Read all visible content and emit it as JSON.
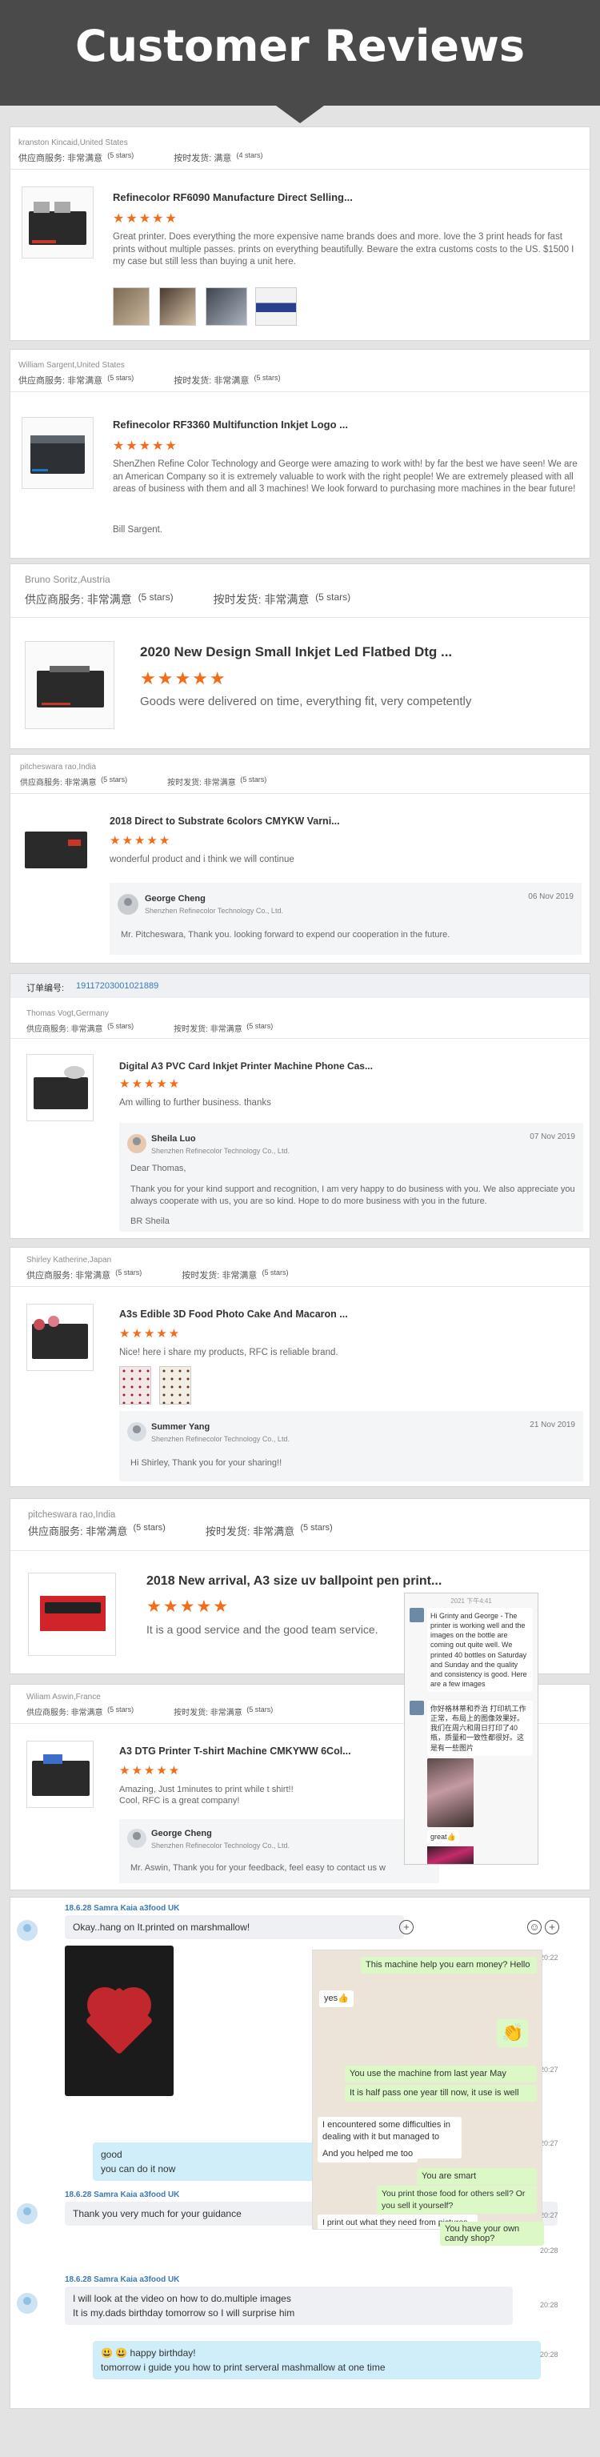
{
  "header": {
    "title": "Customer Reviews"
  },
  "labels": {
    "supplier": "供应商服务:",
    "shipping": "按时发货:",
    "very_satisfied": "非常满意",
    "satisfied": "满意",
    "five_stars": "(5 stars)",
    "four_stars": "(4 stars)",
    "stars_glyph": "★★★★★"
  },
  "reviews": [
    {
      "customer": "kranston Kincaid,United States",
      "supplier_rating": "非常满意",
      "supplier_stars": "(5 stars)",
      "shipping_rating": "满意",
      "shipping_stars": "(4 stars)",
      "product": "Refinecolor RF6090 Manufacture Direct Selling...",
      "stars": 5,
      "text": "Great printer. Does everything the more expensive name brands does and more. love the 3 print heads for fast prints without multiple passes. prints on everything beautifully. Beware the extra customs costs to the US. $1500 I my case but still less than buying a unit here."
    },
    {
      "customer": "William Sargent,United States",
      "supplier_rating": "非常满意",
      "supplier_stars": "(5 stars)",
      "shipping_rating": "非常满意",
      "shipping_stars": "(5 stars)",
      "product": "Refinecolor RF3360 Multifunction Inkjet Logo ...",
      "stars": 5,
      "text": "ShenZhen Refine Color Technology and George were amazing to work with! by far the best we have seen! We are an American Company so it is extremely valuable to work with the right people! We are extremely pleased with all areas of business with them and all 3 machines! We look forward to purchasing more machines in the bear future!",
      "signature": "Bill Sargent."
    },
    {
      "customer": "Bruno Soritz,Austria",
      "supplier_rating": "非常满意",
      "supplier_stars": "(5 stars)",
      "shipping_rating": "非常满意",
      "shipping_stars": "(5 stars)",
      "product": "2020 New Design Small Inkjet Led Flatbed Dtg ...",
      "stars": 5,
      "text": "Goods were delivered on time, everything fit, very competently"
    },
    {
      "customer": "pitcheswara rao,India",
      "supplier_rating": "非常满意",
      "supplier_stars": "(5 stars)",
      "shipping_rating": "非常满意",
      "shipping_stars": "(5 stars)",
      "product": "2018 Direct to Substrate 6colors CMYKW Varni...",
      "stars": 5,
      "text": "wonderful product and i think we will continue",
      "reply": {
        "name": "George Cheng",
        "company": "Shenzhen Refinecolor Technology Co., Ltd.",
        "date": "06 Nov 2019",
        "text": "Mr. Pitcheswara, Thank you. looking forward to expend our cooperation in the future."
      }
    },
    {
      "order_label": "订单编号:",
      "order_no": "19117203001021889",
      "customer": "Thomas Vogt,Germany",
      "supplier_rating": "非常满意",
      "supplier_stars": "(5 stars)",
      "shipping_rating": "非常满意",
      "shipping_stars": "(5 stars)",
      "product": "Digital A3 PVC Card Inkjet Printer Machine Phone Cas...",
      "stars": 5,
      "text": "Am willing to further business. thanks",
      "reply": {
        "name": "Sheila Luo",
        "company": "Shenzhen Refinecolor Technology Co., Ltd.",
        "date": "07 Nov 2019",
        "greeting": "Dear Thomas,",
        "text": "Thank you for your kind support and recognition, I am very happy to do business with you. We also appreciate you always cooperate with us, you are so kind. Hope to do more business with you in the future.",
        "sign": "BR Sheila"
      }
    },
    {
      "customer": "Shirley Katherine,Japan",
      "supplier_rating": "非常满意",
      "supplier_stars": "(5 stars)",
      "shipping_rating": "非常满意",
      "shipping_stars": "(5 stars)",
      "product": "A3s Edible 3D Food Photo Cake And Macaron ...",
      "stars": 5,
      "text": "Nice! here i share my products,  RFC is reliable brand.",
      "reply": {
        "name": "Summer Yang",
        "company": "Shenzhen Refinecolor Technology Co., Ltd.",
        "date": "21 Nov 2019",
        "text": "Hi Shirley, Thank you for your sharing!!"
      }
    },
    {
      "customer": "pitcheswara rao,India",
      "supplier_rating": "非常满意",
      "supplier_stars": "(5 stars)",
      "shipping_rating": "非常满意",
      "shipping_stars": "(5 stars)",
      "product": "2018 New arrival, A3 size uv ballpoint pen print...",
      "stars": 5,
      "text": "It is a good service and the good team service."
    },
    {
      "customer": "Wiliam Aswin,France",
      "supplier_rating": "非常满意",
      "supplier_stars": "(5 stars)",
      "shipping_rating": "非常满意",
      "shipping_stars": "(5 stars)",
      "product": "A3 DTG Printer T-shirt Machine CMKYWW 6Col...",
      "stars": 5,
      "text": "Amazing, Just 1minutes to print while t shirt!!",
      "text2": "Cool, RFC is a great company!",
      "reply": {
        "name": "George Cheng",
        "company": "Shenzhen Refinecolor Technology Co., Ltd.",
        "text": "Mr. Aswin, Thank you for your feedback, feel easy to contact us w"
      }
    }
  ],
  "cn_chat": {
    "time": "2021 下午4:41",
    "msg1": "Hi Grinty and George - The printer is working well and the images on the bottle are coming out quite well. We printed 40 bottles on Saturday and Sunday and the quality and consistency is good. Here are a few images",
    "msg2": "你好格林蒂和乔治 打印机工作正常，布局上的图像效果好。我们在周六和周日打印了40 瓶，质量和一致性都很好。这是有一些图片",
    "great": "great👍"
  },
  "chat": {
    "contact1": "18.6.28 Samra Kaia a3food UK",
    "msg1": "Okay..hang on It.printed on marshmallow!",
    "reply_good": "good",
    "reply_can": "you can do it now",
    "contact2": "18.6.28 Samra Kaia a3food UK",
    "msg2": "Thank you very much for your guidance",
    "contact3": "18.6.28 Samra Kaia a3food UK",
    "msg3a": "I will look at the video on how to do.multiple images",
    "msg3b": "It is my.dads birthday tomorrow so I will surprise him",
    "reply_bday": "😃 😃 happy birthday!",
    "reply_guide": "tomorrow i guide you how to print serveral mashmallow at one time",
    "times": [
      "20:22",
      "20:27",
      "20:27",
      "20:27",
      "20:28",
      "20:28",
      "20:28"
    ]
  },
  "whatsapp": {
    "m1": "This machine help you earn money? Hello",
    "m2": "yes👍",
    "m3": "You use the machine from last year May",
    "m4": "It is half pass one year till now, it use is well",
    "m5": "I encountered some difficulties in dealing with it but managed to work it out",
    "m6": "And you helped me too",
    "m7": "You are smart",
    "m8": "You print those food for others sell? Or you sell it yourself?",
    "m9": "I print out what they need from pictures and phrases",
    "m10": "You have your own candy shop?"
  }
}
